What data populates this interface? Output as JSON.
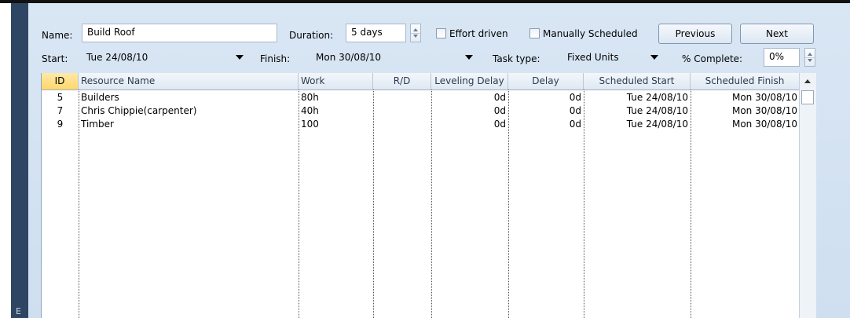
{
  "side_label": "E",
  "form": {
    "name_label": "Name:",
    "name_value": "Build Roof",
    "duration_label": "Duration:",
    "duration_value": "5 days",
    "effort_driven_label": "Effort driven",
    "manually_scheduled_label": "Manually Scheduled",
    "previous_label": "Previous",
    "next_label": "Next",
    "start_label": "Start:",
    "start_value": "Tue 24/08/10",
    "finish_label": "Finish:",
    "finish_value": "Mon 30/08/10",
    "task_type_label": "Task type:",
    "task_type_value": "Fixed Units",
    "complete_label": "% Complete:",
    "complete_value": "0%"
  },
  "table": {
    "columns": [
      "ID",
      "Resource Name",
      "Work",
      "R/D",
      "Leveling Delay",
      "Delay",
      "Scheduled Start",
      "Scheduled Finish"
    ],
    "rows": [
      {
        "id": "5",
        "name": "Builders",
        "work": "80h",
        "rd": "",
        "leveling": "0d",
        "delay": "0d",
        "start": "Tue 24/08/10",
        "finish": "Mon 30/08/10"
      },
      {
        "id": "7",
        "name": "Chris Chippie(carpenter)",
        "work": "40h",
        "rd": "",
        "leveling": "0d",
        "delay": "0d",
        "start": "Tue 24/08/10",
        "finish": "Mon 30/08/10"
      },
      {
        "id": "9",
        "name": "Timber",
        "work": "100",
        "rd": "",
        "leveling": "0d",
        "delay": "0d",
        "start": "Tue 24/08/10",
        "finish": "Mon 30/08/10"
      }
    ]
  },
  "icons": {
    "dropdown": "chevron-down-icon",
    "spinner": "spinner-icon",
    "scroll_up": "scroll-up-icon"
  },
  "colors": {
    "panel_bg": "#d9e6f4",
    "left_bar": "#2e4663",
    "id_header": "#ffd769"
  }
}
